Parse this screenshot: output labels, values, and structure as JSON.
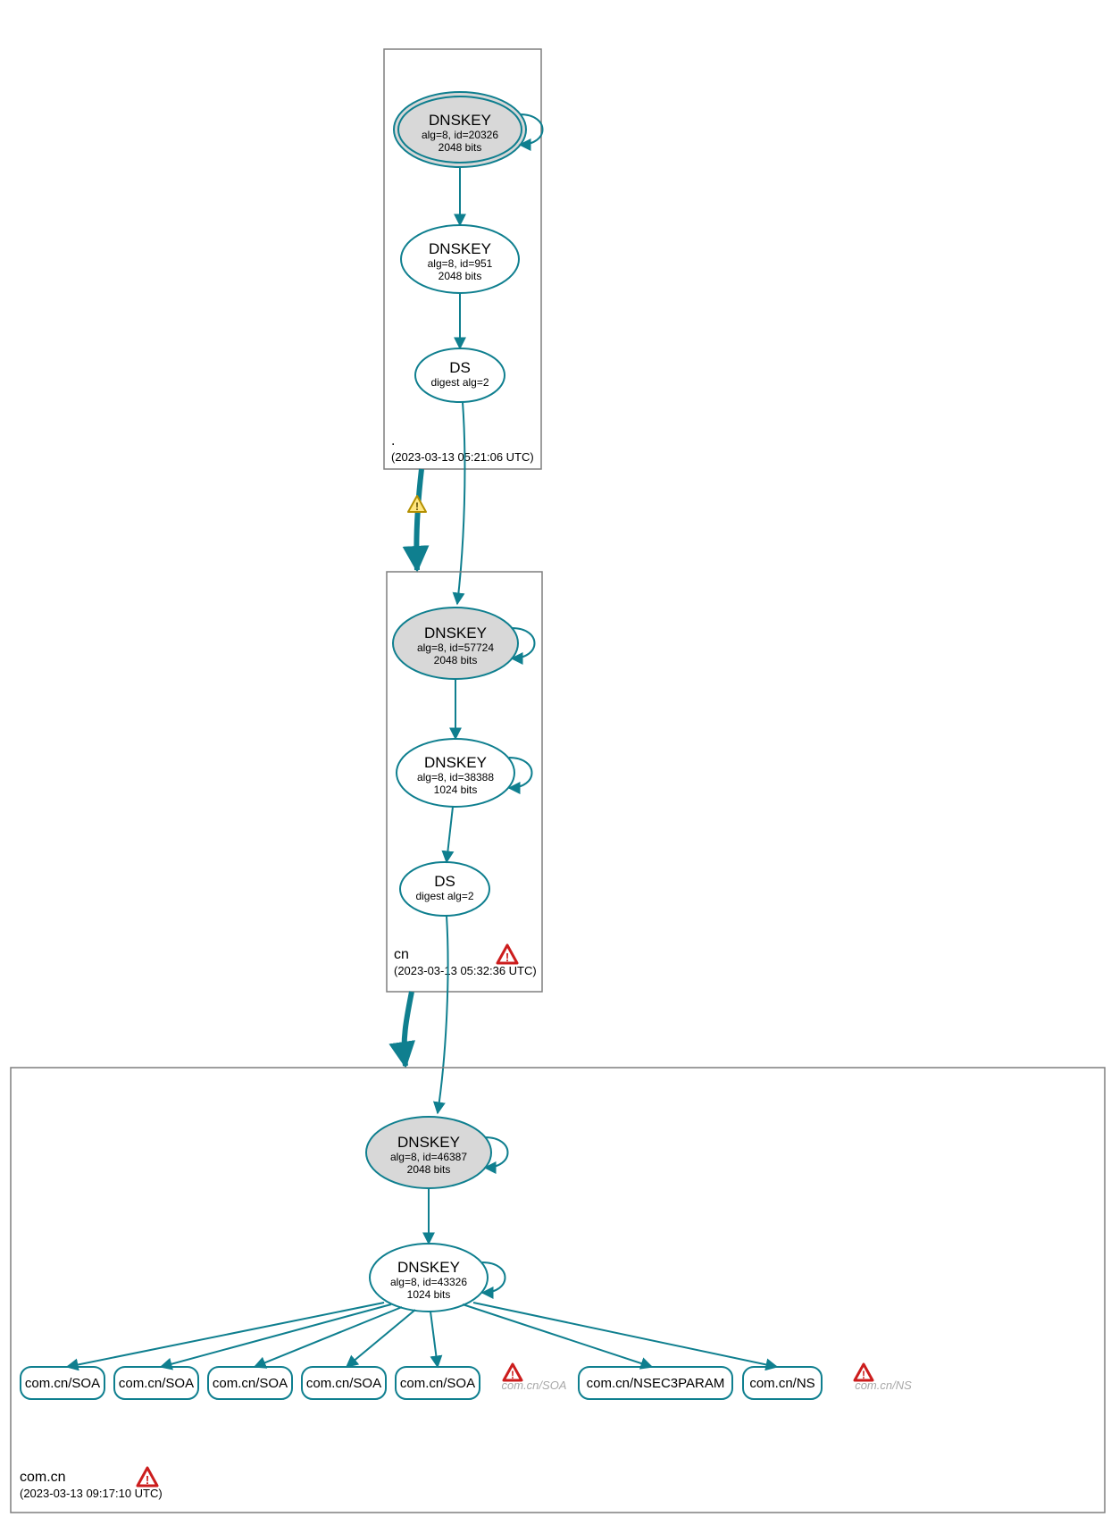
{
  "colors": {
    "stroke": "#0f7f8f",
    "fill_grey": "#d8d8d8",
    "fill_white": "#ffffff",
    "box": "#7f7f7f",
    "text": "#1a1a1a",
    "ghost": "#a8a8a8",
    "warn_yellow_fill": "#ffe680",
    "warn_yellow_stroke": "#b38f00",
    "warn_red_fill": "#ffffff",
    "warn_red_stroke": "#cc1d1d"
  },
  "zones": {
    "root": {
      "name": ".",
      "timestamp": "(2023-03-13 05:21:06 UTC)",
      "nodes": {
        "ksk": {
          "title": "DNSKEY",
          "line2": "alg=8, id=20326",
          "line3": "2048 bits"
        },
        "zsk": {
          "title": "DNSKEY",
          "line2": "alg=8, id=951",
          "line3": "2048 bits"
        },
        "ds": {
          "title": "DS",
          "line2": "digest alg=2"
        }
      }
    },
    "cn": {
      "name": "cn",
      "timestamp": "(2023-03-13 05:32:36 UTC)",
      "nodes": {
        "ksk": {
          "title": "DNSKEY",
          "line2": "alg=8, id=57724",
          "line3": "2048 bits"
        },
        "zsk": {
          "title": "DNSKEY",
          "line2": "alg=8, id=38388",
          "line3": "1024 bits"
        },
        "ds": {
          "title": "DS",
          "line2": "digest alg=2"
        }
      }
    },
    "comcn": {
      "name": "com.cn",
      "timestamp": "(2023-03-13 09:17:10 UTC)",
      "nodes": {
        "ksk": {
          "title": "DNSKEY",
          "line2": "alg=8, id=46387",
          "line3": "2048 bits"
        },
        "zsk": {
          "title": "DNSKEY",
          "line2": "alg=8, id=43326",
          "line3": "1024 bits"
        }
      },
      "leaves": {
        "l1": "com.cn/SOA",
        "l2": "com.cn/SOA",
        "l3": "com.cn/SOA",
        "l4": "com.cn/SOA",
        "l5": "com.cn/SOA",
        "g1": "com.cn/SOA",
        "l6": "com.cn/NSEC3PARAM",
        "l7": "com.cn/NS",
        "g2": "com.cn/NS"
      }
    }
  }
}
